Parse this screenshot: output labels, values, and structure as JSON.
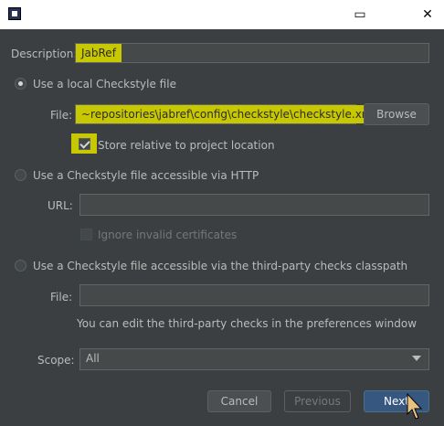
{
  "window": {
    "title": ""
  },
  "description": {
    "label": "Description:",
    "value": "JabRef"
  },
  "local": {
    "radio_label": "Use a local Checkstyle file",
    "file_label": "File:",
    "file_value": "~repositories\\jabref\\config\\checkstyle\\checkstyle.xml",
    "browse_label": "Browse",
    "store_relative_label": "Store relative to project location",
    "store_relative_checked": true
  },
  "http": {
    "radio_label": "Use a Checkstyle file accessible via HTTP",
    "url_label": "URL:",
    "url_value": "",
    "ignore_invalid_label": "Ignore invalid certificates"
  },
  "thirdparty": {
    "radio_label": "Use a Checkstyle file accessible via the third-party checks classpath",
    "file_label": "File:",
    "file_value": "",
    "hint": "You can edit the third-party checks in the preferences window"
  },
  "scope": {
    "label": "Scope:",
    "value": "All"
  },
  "buttons": {
    "cancel": "Cancel",
    "previous": "Previous",
    "next": "Next"
  }
}
